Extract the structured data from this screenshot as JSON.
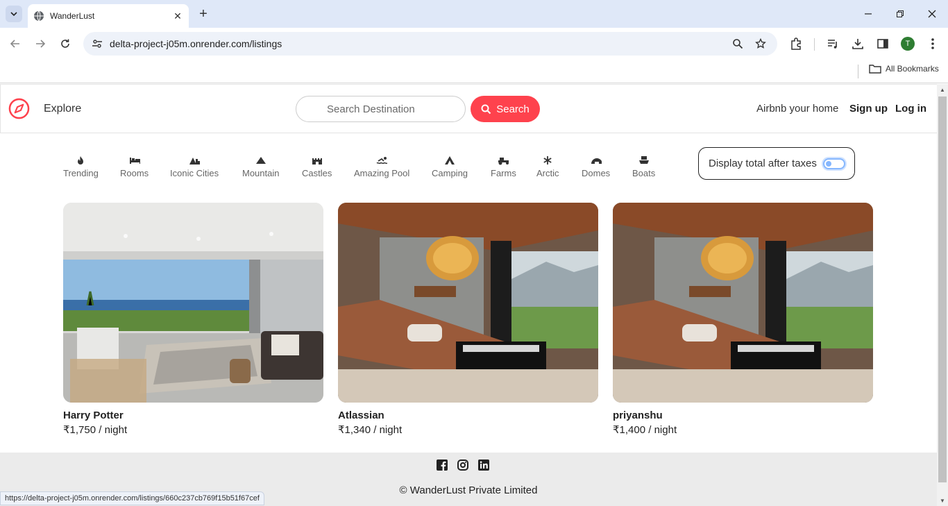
{
  "browser": {
    "tab_title": "WanderLust",
    "url": "delta-project-j05m.onrender.com/listings",
    "all_bookmarks": "All Bookmarks",
    "profile_initial": "T",
    "status_url": "https://delta-project-j05m.onrender.com/listings/660c237cb769f15b51f67cef"
  },
  "navbar": {
    "explore": "Explore",
    "search_placeholder": "Search Destination",
    "search_button": "Search",
    "host_link": "Airbnb your home",
    "signup": "Sign up",
    "login": "Log in",
    "brand_color": "#fe424d"
  },
  "filters": [
    {
      "label": "Trending",
      "icon": "fire-icon"
    },
    {
      "label": "Rooms",
      "icon": "bed-icon"
    },
    {
      "label": "Iconic Cities",
      "icon": "mountain-city-icon"
    },
    {
      "label": "Mountain",
      "icon": "mountain-icon"
    },
    {
      "label": "Castles",
      "icon": "castle-icon"
    },
    {
      "label": "Amazing Pool",
      "icon": "person-swimming-icon"
    },
    {
      "label": "Camping",
      "icon": "campground-icon"
    },
    {
      "label": "Farms",
      "icon": "tractor-icon"
    },
    {
      "label": "Arctic",
      "icon": "snowflake-icon"
    },
    {
      "label": "Domes",
      "icon": "igloo-icon"
    },
    {
      "label": "Boats",
      "icon": "ship-icon"
    }
  ],
  "tax_toggle": {
    "label": "Display total after taxes",
    "checked": false
  },
  "listings": [
    {
      "title": "Harry Potter",
      "price": "₹1,750 / night",
      "image": "modern-living-room-ocean-view"
    },
    {
      "title": "Atlassian",
      "price": "₹1,340 / night",
      "image": "wood-cabin-lake-living-room"
    },
    {
      "title": "priyanshu",
      "price": "₹1,400 / night",
      "image": "wood-cabin-lake-living-room"
    }
  ],
  "footer": {
    "socials": [
      "facebook-icon",
      "instagram-icon",
      "linkedin-icon"
    ],
    "copyright": "© WanderLust Private Limited"
  }
}
